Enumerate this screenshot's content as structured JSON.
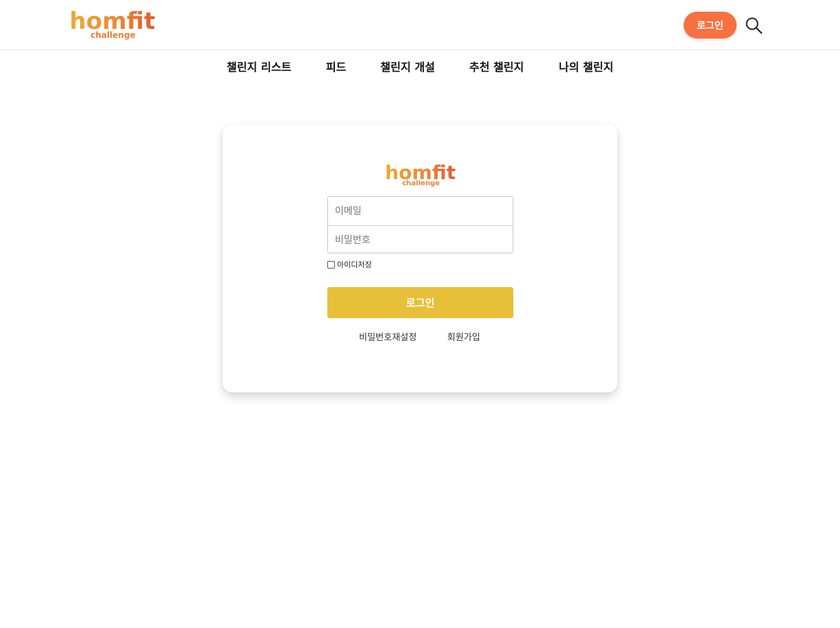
{
  "brand": {
    "logo_word": "homfit",
    "logo_sub": "challenge",
    "colors": {
      "accent_orange": "#f6713f",
      "login_yellow": "#e8bf39",
      "logo_gradient_start": "#e8ac38",
      "logo_gradient_end": "#e35a30"
    }
  },
  "header": {
    "login_button": "로그인",
    "search_icon": "search-icon"
  },
  "nav": {
    "items": [
      {
        "label": "챌린지 리스트"
      },
      {
        "label": "피드"
      },
      {
        "label": "챌린지 개설"
      },
      {
        "label": "추천 챌린지"
      },
      {
        "label": "나의 챌린지"
      }
    ]
  },
  "login_form": {
    "email_placeholder": "이메일",
    "password_placeholder": "비밀번호",
    "remember_label": "아이디저장",
    "remember_checked": false,
    "submit_label": "로그인",
    "reset_password_link": "비밀번호재설정",
    "signup_link": "회원가입"
  }
}
